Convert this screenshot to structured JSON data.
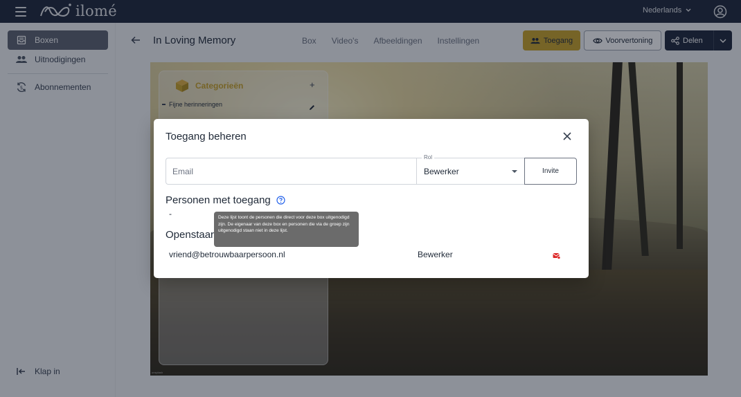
{
  "topbar": {
    "logo_text": "ilomé",
    "language": "Nederlands"
  },
  "sidebar": {
    "items": [
      {
        "label": "Boxen",
        "icon": "inbox-icon",
        "active": true
      },
      {
        "label": "Uitnodigingen",
        "icon": "people-icon",
        "active": false
      },
      {
        "label": "Abonnementen",
        "icon": "subscription-icon",
        "active": false
      }
    ],
    "collapse_label": "Klap in"
  },
  "header": {
    "title": "In Loving Memory",
    "tabs": [
      "Box",
      "Video's",
      "Afbeeldingen",
      "Instellingen"
    ],
    "toegang_label": "Toegang",
    "preview_label": "Voorvertoning",
    "share_label": "Delen"
  },
  "categories": {
    "title": "Categorieën",
    "items": [
      "Fijne herinneringen"
    ]
  },
  "photo": {
    "credit": "unsplash"
  },
  "modal": {
    "title": "Toegang beheren",
    "email_placeholder": "Email",
    "role_label": "Rol",
    "role_value": "Bewerker",
    "invite_label": "Invite",
    "people_section": "Personen met toegang",
    "people_empty": "-",
    "open_section": "Openstaande uitnodigingen",
    "open_section_visible": "Openstaar",
    "pending": [
      {
        "email": "vriend@betrouwbaarpersoon.nl",
        "role": "Bewerker"
      }
    ],
    "tooltip": "Deze lijst toont de personen die direct voor deze box uitgenodigd zijn. De eigenaar van deze box en personen die via de groep zijn uitgenodigd staan niet in deze lijst."
  },
  "colors": {
    "topbar": "#1c2639",
    "accent": "#c9a227",
    "delete": "#dc2626",
    "help": "#2563eb"
  }
}
